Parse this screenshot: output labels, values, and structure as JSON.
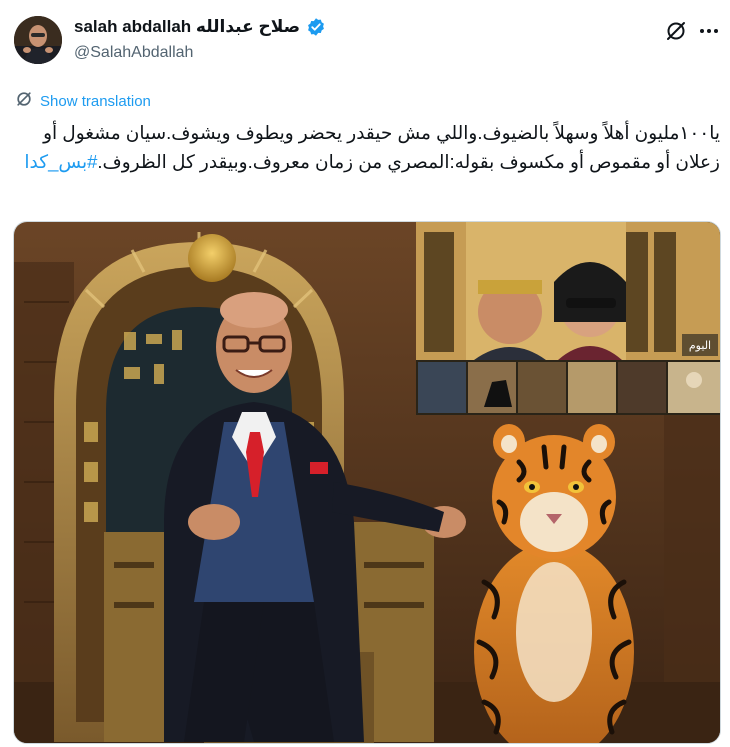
{
  "author": {
    "display_name": "salah abdallah صلاح عبدالله",
    "handle": "@SalahAbdallah",
    "verified": true
  },
  "actions": {
    "grok_icon": "grok-slash-icon",
    "more_icon": "more-horizontal-icon"
  },
  "translate": {
    "label": "Show translation",
    "icon": "translate-icon"
  },
  "tweet": {
    "body": "يا١٠٠مليون أهلاً وسهلاً بالضيوف.واللي مش حيقدر يحضر ويطوف ويشوف.سيان مشغول أو زعلان أو مقموص أو مكسوف بقوله:المصري من زمان معروف.وبيقدر كل الظروف.",
    "hashtag": "#بس_كدا"
  },
  "media": {
    "inset_badge": "اليوم"
  },
  "colors": {
    "accent": "#1d9bf0",
    "text": "#0f1419",
    "secondary": "#536471"
  }
}
